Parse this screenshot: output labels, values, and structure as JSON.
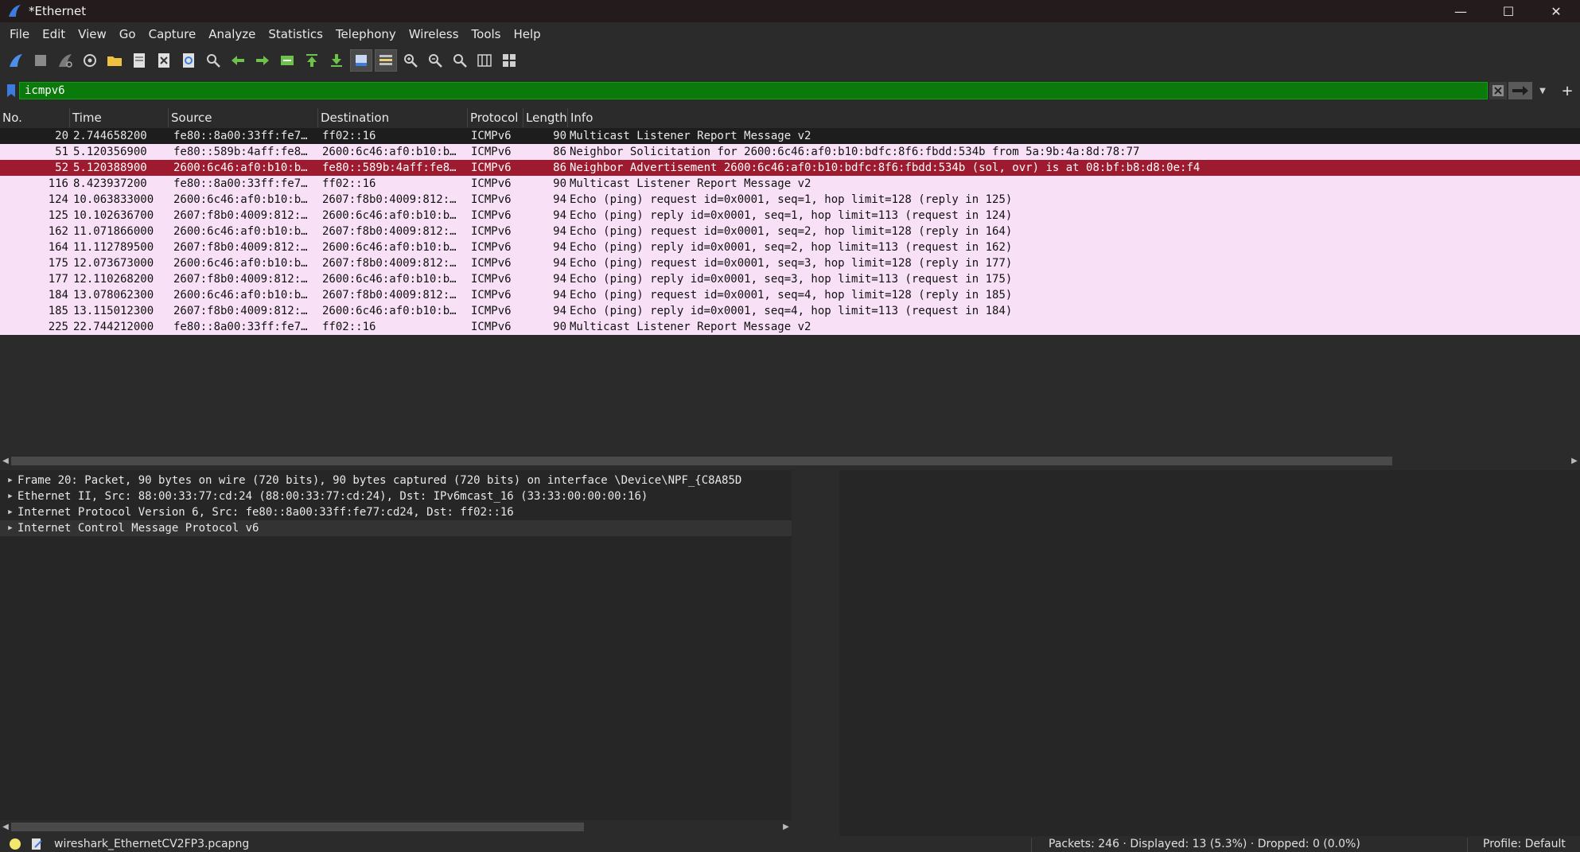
{
  "window": {
    "title": "*Ethernet"
  },
  "menu": [
    "File",
    "Edit",
    "View",
    "Go",
    "Capture",
    "Analyze",
    "Statistics",
    "Telephony",
    "Wireless",
    "Tools",
    "Help"
  ],
  "filter": {
    "value": "icmpv6"
  },
  "columns": {
    "no": "No.",
    "time": "Time",
    "source": "Source",
    "destination": "Destination",
    "protocol": "Protocol",
    "length": "Length",
    "info": "Info"
  },
  "packets": [
    {
      "no": "20",
      "time": "2.744658200",
      "source": "fe80::8a00:33ff:fe7…",
      "destination": "ff02::16",
      "protocol": "ICMPv6",
      "length": "90",
      "info": "Multicast Listener Report Message v2"
    },
    {
      "no": "51",
      "time": "5.120356900",
      "source": "fe80::589b:4aff:fe8…",
      "destination": "2600:6c46:af0:b10:b…",
      "protocol": "ICMPv6",
      "length": "86",
      "info": "Neighbor Solicitation for 2600:6c46:af0:b10:bdfc:8f6:fbdd:534b from 5a:9b:4a:8d:78:77"
    },
    {
      "no": "52",
      "time": "5.120388900",
      "source": "2600:6c46:af0:b10:b…",
      "destination": "fe80::589b:4aff:fe8…",
      "protocol": "ICMPv6",
      "length": "86",
      "info": "Neighbor Advertisement 2600:6c46:af0:b10:bdfc:8f6:fbdd:534b (sol, ovr) is at 08:bf:b8:d8:0e:f4"
    },
    {
      "no": "116",
      "time": "8.423937200",
      "source": "fe80::8a00:33ff:fe7…",
      "destination": "ff02::16",
      "protocol": "ICMPv6",
      "length": "90",
      "info": "Multicast Listener Report Message v2"
    },
    {
      "no": "124",
      "time": "10.063833000",
      "source": "2600:6c46:af0:b10:b…",
      "destination": "2607:f8b0:4009:812:…",
      "protocol": "ICMPv6",
      "length": "94",
      "info": "Echo (ping) request id=0x0001, seq=1, hop limit=128 (reply in 125)"
    },
    {
      "no": "125",
      "time": "10.102636700",
      "source": "2607:f8b0:4009:812:…",
      "destination": "2600:6c46:af0:b10:b…",
      "protocol": "ICMPv6",
      "length": "94",
      "info": "Echo (ping) reply id=0x0001, seq=1, hop limit=113 (request in 124)"
    },
    {
      "no": "162",
      "time": "11.071866000",
      "source": "2600:6c46:af0:b10:b…",
      "destination": "2607:f8b0:4009:812:…",
      "protocol": "ICMPv6",
      "length": "94",
      "info": "Echo (ping) request id=0x0001, seq=2, hop limit=128 (reply in 164)"
    },
    {
      "no": "164",
      "time": "11.112789500",
      "source": "2607:f8b0:4009:812:…",
      "destination": "2600:6c46:af0:b10:b…",
      "protocol": "ICMPv6",
      "length": "94",
      "info": "Echo (ping) reply id=0x0001, seq=2, hop limit=113 (request in 162)"
    },
    {
      "no": "175",
      "time": "12.073673000",
      "source": "2600:6c46:af0:b10:b…",
      "destination": "2607:f8b0:4009:812:…",
      "protocol": "ICMPv6",
      "length": "94",
      "info": "Echo (ping) request id=0x0001, seq=3, hop limit=128 (reply in 177)"
    },
    {
      "no": "177",
      "time": "12.110268200",
      "source": "2607:f8b0:4009:812:…",
      "destination": "2600:6c46:af0:b10:b…",
      "protocol": "ICMPv6",
      "length": "94",
      "info": "Echo (ping) reply id=0x0001, seq=3, hop limit=113 (request in 175)"
    },
    {
      "no": "184",
      "time": "13.078062300",
      "source": "2600:6c46:af0:b10:b…",
      "destination": "2607:f8b0:4009:812:…",
      "protocol": "ICMPv6",
      "length": "94",
      "info": "Echo (ping) request id=0x0001, seq=4, hop limit=128 (reply in 185)"
    },
    {
      "no": "185",
      "time": "13.115012300",
      "source": "2607:f8b0:4009:812:…",
      "destination": "2600:6c46:af0:b10:b…",
      "protocol": "ICMPv6",
      "length": "94",
      "info": "Echo (ping) reply id=0x0001, seq=4, hop limit=113 (request in 184)"
    },
    {
      "no": "225",
      "time": "22.744212000",
      "source": "fe80::8a00:33ff:fe7…",
      "destination": "ff02::16",
      "protocol": "ICMPv6",
      "length": "90",
      "info": "Multicast Listener Report Message v2"
    }
  ],
  "details": [
    "Frame 20: Packet, 90 bytes on wire (720 bits), 90 bytes captured (720 bits) on interface \\Device\\NPF_{C8A85D",
    "Ethernet II, Src: 88:00:33:77:cd:24 (88:00:33:77:cd:24), Dst: IPv6mcast_16 (33:33:00:00:00:16)",
    "Internet Protocol Version 6, Src: fe80::8a00:33ff:fe77:cd24, Dst: ff02::16",
    "Internet Control Message Protocol v6"
  ],
  "status": {
    "file": "wireshark_EthernetCV2FP3.pcapng",
    "packets": "Packets: 246 · Displayed: 13 (5.3%) · Dropped: 0 (0.0%)",
    "profile": "Profile: Default"
  },
  "colors": {
    "filter_valid": "#0a7a0a",
    "row_icmp": "#f8e1f6",
    "row_selected": "#9d1a2f",
    "accent_blue": "#3c7be0"
  },
  "toolbar_icons": [
    "shark-fin-start-icon",
    "stop-square-icon",
    "restart-fin-icon",
    "capture-options-gear-icon",
    "open-folder-icon",
    "save-file-icon",
    "close-file-icon",
    "reload-file-icon",
    "find-packet-icon",
    "go-back-icon",
    "go-forward-icon",
    "go-to-packet-icon",
    "go-first-icon",
    "go-last-icon",
    "autoscroll-icon",
    "colorize-icon",
    "zoom-in-icon",
    "zoom-out-icon",
    "zoom-normal-icon",
    "resize-columns-icon",
    "layout-icon"
  ]
}
